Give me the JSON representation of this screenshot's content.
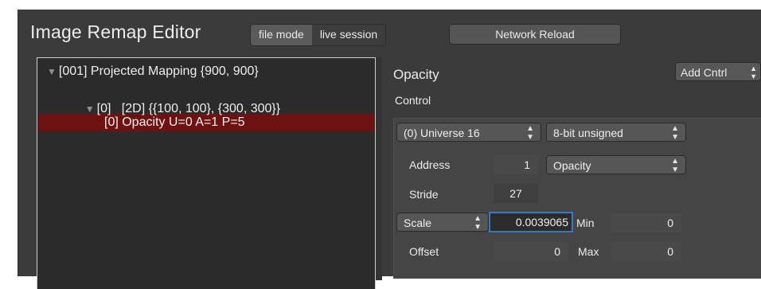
{
  "header": {
    "title": "Image Remap Editor",
    "modes": [
      "file mode",
      "live session"
    ],
    "network_reload": "Network Reload"
  },
  "tree": {
    "rows": [
      "[001] Projected Mapping {900, 900}",
      "[0]   [2D] {{100, 100}, {300, 300}}",
      "[0] Opacity U=0 A=1 P=5"
    ]
  },
  "panel": {
    "heading": "Opacity",
    "subheading": "Control",
    "add_button": "Add Cntrl",
    "universe": "(0) Universe 16",
    "format": "8-bit unsigned",
    "address_label": "Address",
    "address_value": "1",
    "address_type": "Opacity",
    "stride_label": "Stride",
    "stride_value": "27",
    "scale_select": "Scale",
    "scale_value": "0.0039065",
    "min_label": "Min",
    "min_value": "0",
    "offset_label": "Offset",
    "offset_value": "0",
    "max_label": "Max",
    "max_value": "0"
  },
  "colors": {
    "selection": "#6d1211",
    "focus_ring": "#3b78c4",
    "background": "#3b3b3b"
  }
}
